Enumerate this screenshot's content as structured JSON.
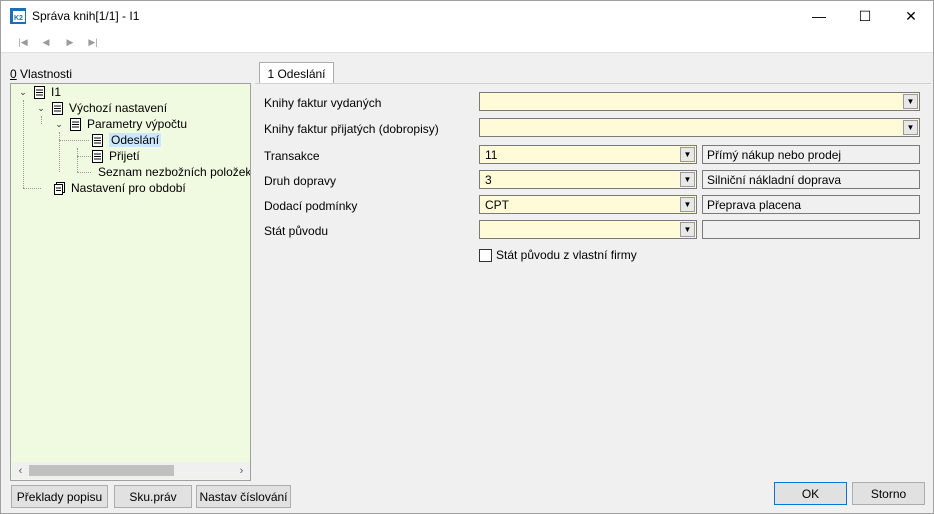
{
  "window": {
    "title": "Správa knih[1/1] - I1",
    "app_icon_text": "K2",
    "controls": {
      "minimize": "—",
      "maximize": "☐",
      "close": "✕"
    }
  },
  "toolbar": {
    "first": "|◀",
    "prev": "◀",
    "next": "▶",
    "last": "▶|"
  },
  "left_panel": {
    "label_prefix": "0",
    "label_rest": " Vlastnosti",
    "tree": [
      {
        "label": "I1"
      },
      {
        "label": "Výchozí nastavení"
      },
      {
        "label": "Parametry výpočtu"
      },
      {
        "label": "Odeslání",
        "selected": true
      },
      {
        "label": "Přijetí"
      },
      {
        "label": "Seznam nezbožních položek p"
      },
      {
        "label": "Nastavení pro období"
      }
    ]
  },
  "tab": {
    "label": "1 Odeslání"
  },
  "form": {
    "knihy_vydanych": {
      "label": "Knihy faktur vydaných",
      "value": ""
    },
    "knihy_prijatych": {
      "label": "Knihy faktur přijatých (dobropisy)",
      "value": ""
    },
    "transakce": {
      "label": "Transakce",
      "value": "11",
      "desc": "Přímý nákup nebo prodej"
    },
    "druh_dopravy": {
      "label": "Druh dopravy",
      "value": "3",
      "desc": "Silniční nákladní doprava"
    },
    "dodaci_podminky": {
      "label": "Dodací podmínky",
      "value": "CPT",
      "desc": "Přeprava placena"
    },
    "stat_puvodu": {
      "label": "Stát původu",
      "value": "",
      "desc": ""
    },
    "stat_puvodu_firmy": {
      "label": "Stát původu z vlastní firmy",
      "checked": false
    }
  },
  "buttons": {
    "preklady": "Překlady popisu",
    "sku": "Sku.práv",
    "nastav": "Nastav číslování",
    "ok": "OK",
    "storno": "Storno"
  }
}
